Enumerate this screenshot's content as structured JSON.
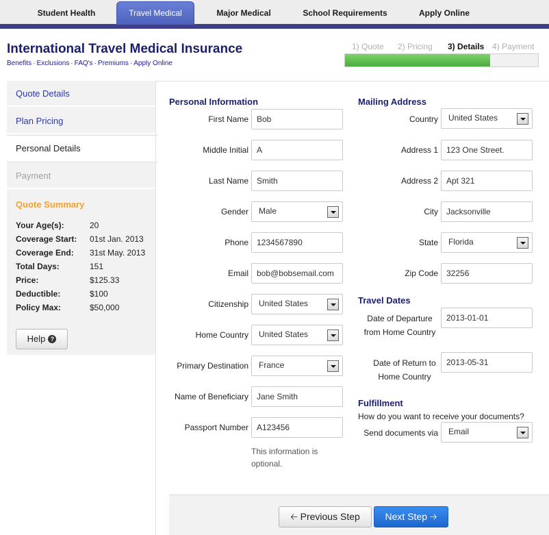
{
  "nav": {
    "tabs": [
      {
        "label": "Student Health"
      },
      {
        "label": "Travel Medical"
      },
      {
        "label": "Major Medical"
      },
      {
        "label": "School Requirements"
      },
      {
        "label": "Apply Online"
      }
    ]
  },
  "header": {
    "title": "International Travel Medical Insurance",
    "links": [
      "Benefits",
      "Exclusions",
      "FAQ's",
      "Premiums",
      "Apply Online"
    ],
    "link_separator": "·"
  },
  "progress": {
    "steps": [
      "1) Quote",
      "2) Pricing",
      "3) Details",
      "4) Payment"
    ],
    "current_step": 3,
    "fill_percent": 75
  },
  "sidebar": {
    "items": [
      {
        "label": "Quote Details"
      },
      {
        "label": "Plan Pricing"
      },
      {
        "label": "Personal Details"
      },
      {
        "label": "Payment"
      }
    ],
    "summary_title": "Quote Summary",
    "summary": [
      {
        "key": "Your Age(s):",
        "value": "20"
      },
      {
        "key": "Coverage Start:",
        "value": "01st Jan. 2013"
      },
      {
        "key": "Coverage End:",
        "value": "31st May. 2013"
      },
      {
        "key": "Total Days:",
        "value": "151"
      },
      {
        "key": "Price:",
        "value": "$125.33"
      },
      {
        "key": "Deductible:",
        "value": "$100"
      },
      {
        "key": "Policy Max:",
        "value": "$50,000"
      }
    ],
    "help_label": "Help",
    "help_icon": "question-circle-icon"
  },
  "personal": {
    "title": "Personal Information",
    "first_name": {
      "label": "First Name",
      "value": "Bob"
    },
    "middle_initial": {
      "label": "Middle Initial",
      "value": "A"
    },
    "last_name": {
      "label": "Last Name",
      "value": "Smith"
    },
    "gender": {
      "label": "Gender",
      "value": "Male"
    },
    "phone": {
      "label": "Phone",
      "value": "1234567890"
    },
    "email": {
      "label": "Email",
      "value": "bob@bobsemail.com"
    },
    "citizenship": {
      "label": "Citizenship",
      "value": "United States"
    },
    "home_country": {
      "label": "Home Country",
      "value": "United States"
    },
    "primary_destination": {
      "label": "Primary Destination",
      "value": "France"
    },
    "beneficiary": {
      "label": "Name of Beneficiary",
      "value": "Jane Smith"
    },
    "passport": {
      "label": "Passport Number",
      "value": "A123456"
    },
    "note": "This information is optional."
  },
  "mailing": {
    "title": "Mailing Address",
    "country": {
      "label": "Country",
      "value": "United States"
    },
    "address1": {
      "label": "Address 1",
      "value": "123 One Street."
    },
    "address2": {
      "label": "Address 2",
      "value": "Apt 321"
    },
    "city": {
      "label": "City",
      "value": "Jacksonville"
    },
    "state": {
      "label": "State",
      "value": "Florida"
    },
    "zip": {
      "label": "Zip Code",
      "value": "32256"
    }
  },
  "travel_dates": {
    "title": "Travel Dates",
    "departure": {
      "label": "Date of Departure from Home Country",
      "value": "2013-01-01"
    },
    "return": {
      "label": "Date of Return to Home Country",
      "value": "2013-05-31"
    }
  },
  "fulfillment": {
    "title": "Fulfillment",
    "question": "How do you want to receive your documents?",
    "send_via": {
      "label": "Send documents via",
      "value": "Email"
    }
  },
  "footer": {
    "prev_label": "Previous Step",
    "next_label": "Next Step",
    "prev_icon": "arrow-left-icon",
    "next_icon": "arrow-right-icon"
  },
  "colors": {
    "nav_accent": "#3e3f8c",
    "title_color": "#1b1f6b",
    "summary_title": "#f0a030",
    "progress_green": "#4cab3f",
    "next_button": "#1c66cf"
  }
}
